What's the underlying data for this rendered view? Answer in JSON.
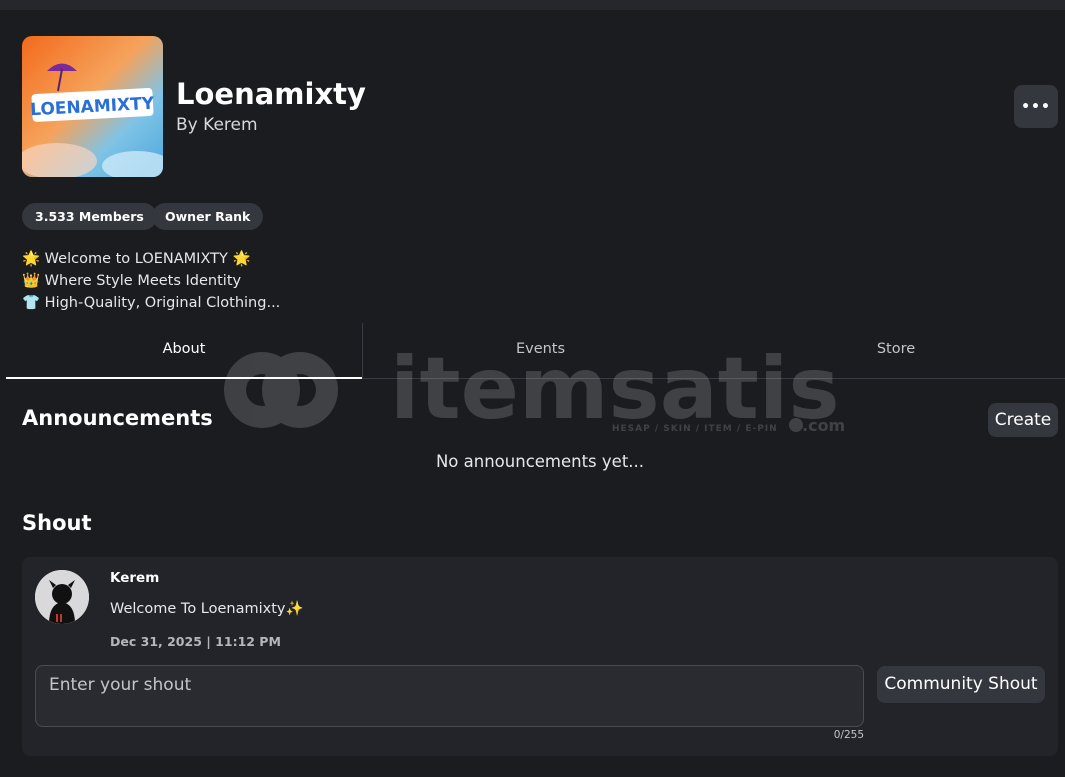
{
  "group": {
    "name": "Loenamixty",
    "by_label": "By",
    "owner": "Kerem",
    "logo_text": "LOENAMIXTY",
    "members_chip": "3.533 Members",
    "rank_chip": "Owner Rank",
    "description": [
      "🌟 Welcome to LOENAMIXTY 🌟",
      "👑 Where Style Meets Identity",
      "👕 High-Quality, Original Clothing..."
    ]
  },
  "menu": {
    "more_icon": "ellipsis-icon",
    "more_label": "•••"
  },
  "tabs": [
    {
      "label": "About",
      "active": true
    },
    {
      "label": "Events",
      "active": false
    },
    {
      "label": "Store",
      "active": false
    }
  ],
  "announcements": {
    "title": "Announcements",
    "create_label": "Create",
    "empty_text": "No announcements yet..."
  },
  "shout": {
    "title": "Shout",
    "author": "Kerem",
    "message": "Welcome To Loenamixty✨",
    "timestamp": "Dec 31, 2025 | 11:12 PM",
    "input_placeholder": "Enter your shout",
    "char_count": "0/255",
    "button_label": "Community Shout"
  },
  "watermark": {
    "brand": "itemsatis",
    "tagline": "HESAP / SKIN / ITEM / E-PIN",
    "suffix": ".com"
  },
  "colors": {
    "background": "#1b1c20",
    "surface": "#232429",
    "button": "#35373e",
    "text": "#ffffff"
  }
}
